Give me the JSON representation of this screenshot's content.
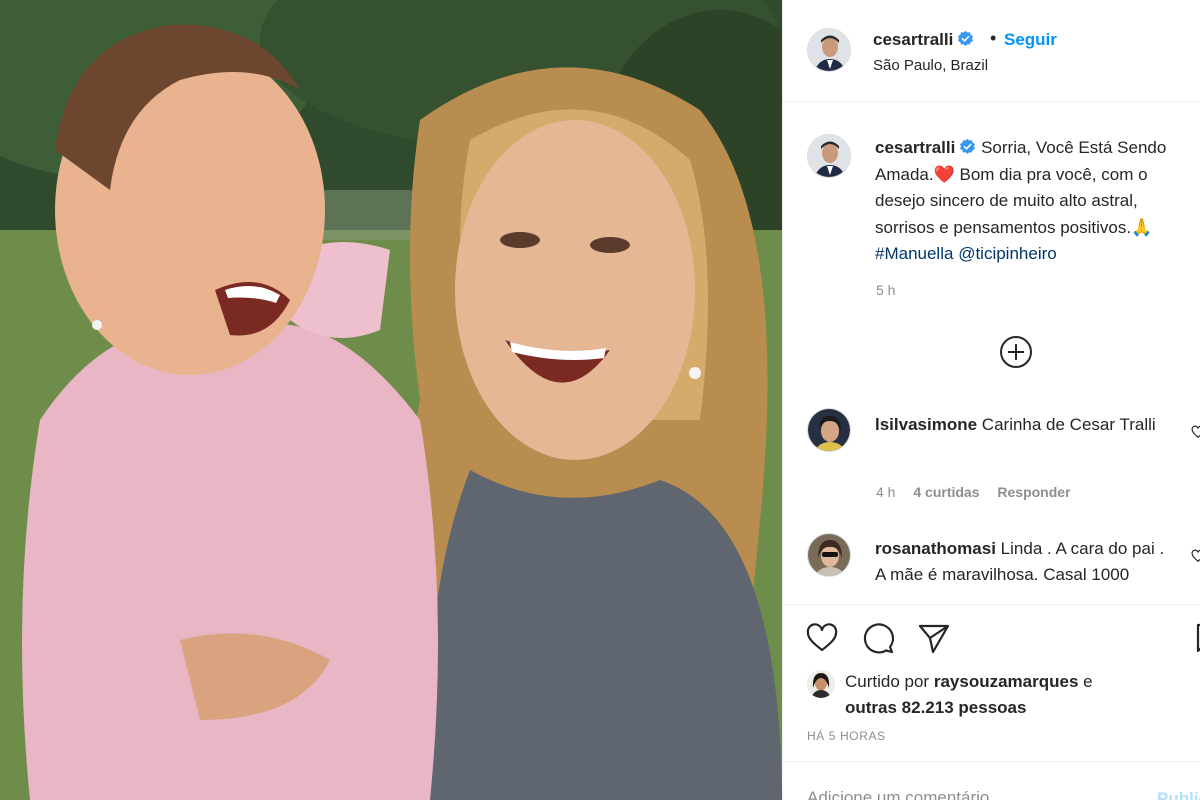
{
  "post": {
    "image_alt": "Woman and laughing baby in pink jacket outdoors"
  },
  "header": {
    "username": "cesartralli",
    "verified_icon": "verified-badge-icon",
    "dot": "•",
    "follow_label": "Seguir",
    "location": "São Paulo, Brazil"
  },
  "caption": {
    "username": "cesartralli",
    "text_part1": "Sorria, Você Está Sendo Amada.",
    "emoji_heart": "❤️",
    "text_part2": "Bom dia pra você, com o desejo sincero de muito alto astral, sorrisos e pensamentos positivos.",
    "emoji_pray": "🙏",
    "hashtag": "#Manuella",
    "mention": "@ticipinheiro",
    "time": "5 h"
  },
  "comments": [
    {
      "username": "lsilvasimone",
      "text": "Carinha de Cesar Tralli",
      "time": "4 h",
      "likes": "4 curtidas",
      "reply": "Responder"
    },
    {
      "username": "rosanathomasi",
      "text": "Linda . A cara do pai . A mãe é maravilhosa. Casal 1000"
    }
  ],
  "actions": {
    "liked_by_prefix": "Curtido por",
    "liked_by_user": "raysouzamarques",
    "liked_by_and": "e",
    "liked_by_others": "outras 82.213 pessoas",
    "post_age": "HÁ 5 HORAS"
  },
  "add_comment": {
    "placeholder": "Adicione um comentário...",
    "publish_label": "Publicar"
  },
  "colors": {
    "accent": "#0095f6",
    "link": "#00376b",
    "muted": "#8e8e8e",
    "publish_disabled": "#b2dffc"
  }
}
